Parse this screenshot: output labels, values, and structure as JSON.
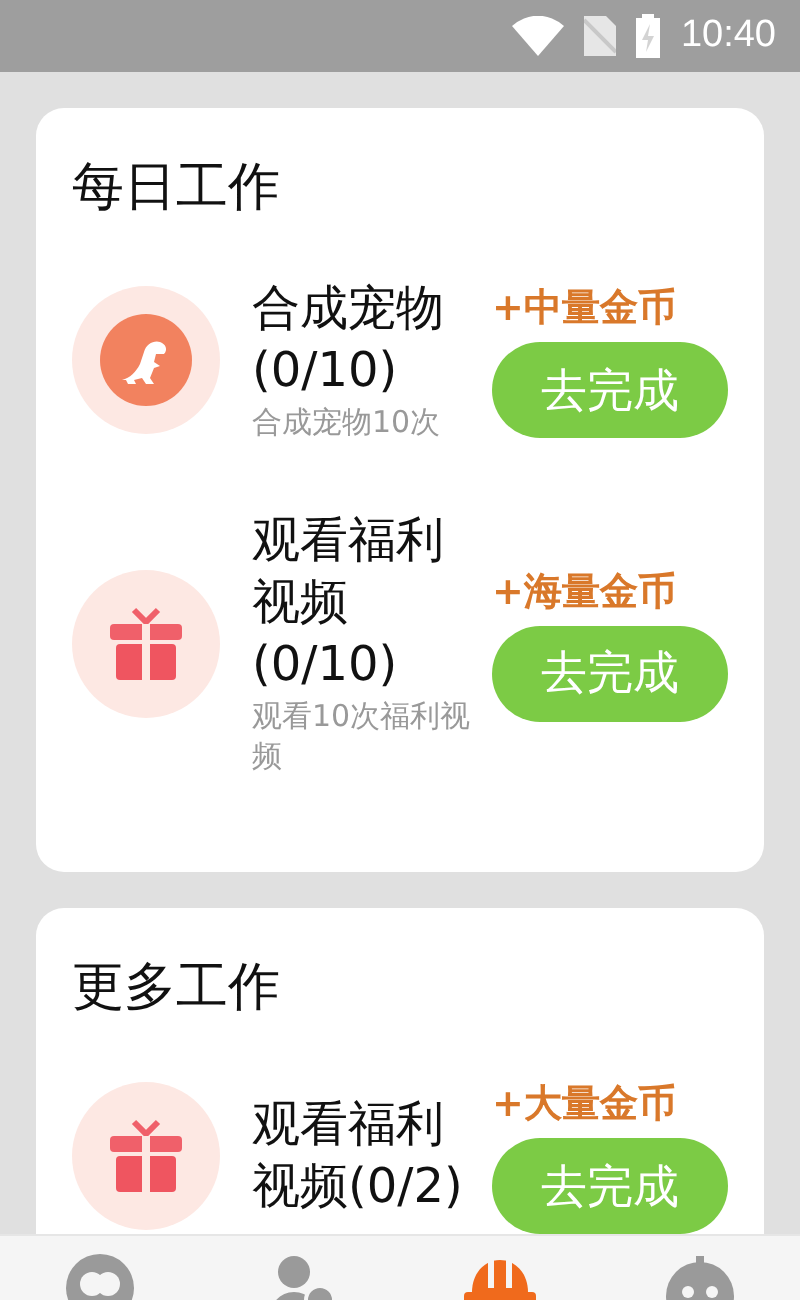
{
  "status_bar": {
    "time": "10:40"
  },
  "sections": [
    {
      "title": "每日工作",
      "tasks": [
        {
          "kind": "dino",
          "title": "合成宠物(0/10)",
          "subtitle": "合成宠物10次",
          "reward": "+中量金币",
          "button": "去完成"
        },
        {
          "kind": "gift",
          "title": "观看福利视频(0/10)",
          "subtitle": "观看10次福利视频",
          "reward": "+海量金币",
          "button": "去完成"
        }
      ]
    },
    {
      "title": "更多工作",
      "tasks": [
        {
          "kind": "gift",
          "title": "观看福利视频(0/2)",
          "reward": "+大量金币",
          "button": "去完成"
        }
      ]
    }
  ],
  "nav": [
    {
      "kind": "chat",
      "selected": false
    },
    {
      "kind": "person",
      "selected": false
    },
    {
      "kind": "helmet",
      "selected": true
    },
    {
      "kind": "robot",
      "selected": false
    }
  ]
}
